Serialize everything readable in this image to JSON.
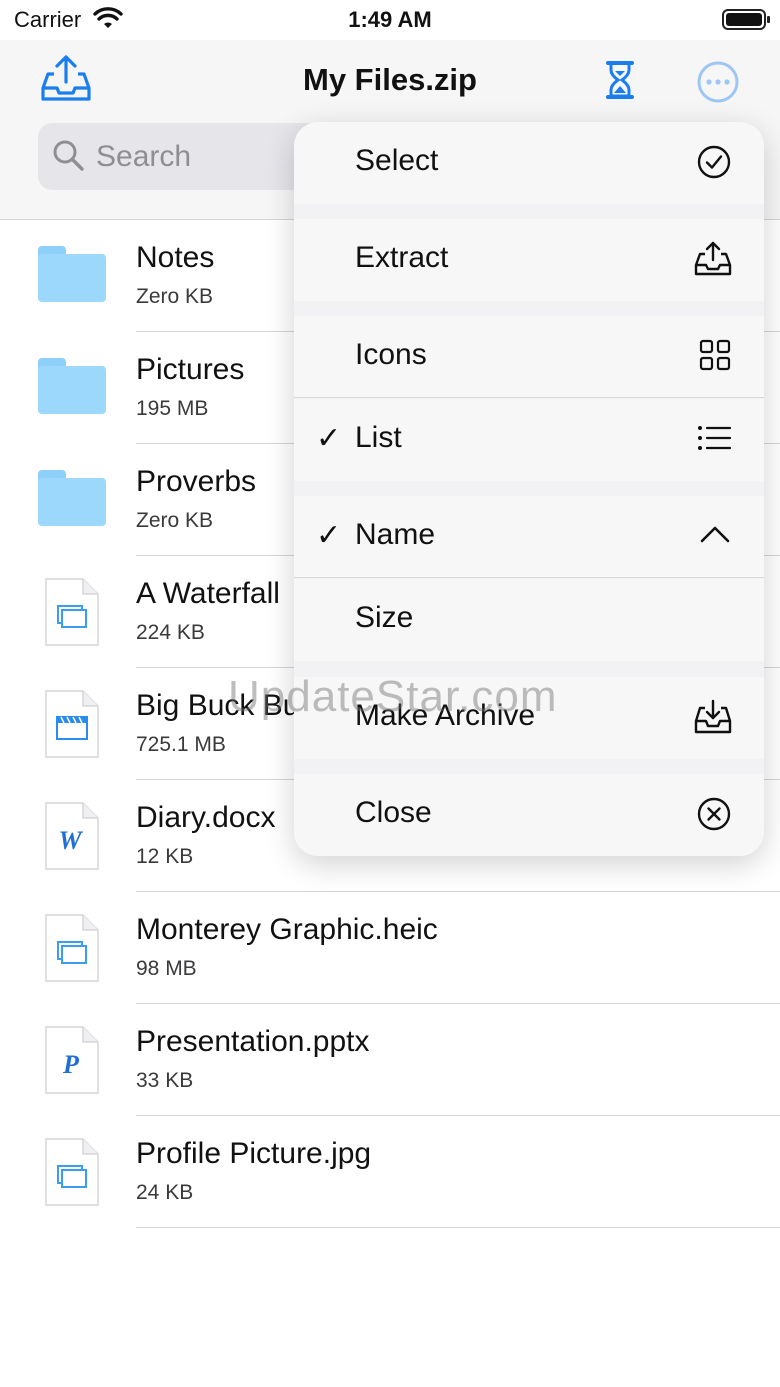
{
  "status_bar": {
    "carrier": "Carrier",
    "time": "1:49 AM"
  },
  "nav": {
    "title": "My Files.zip"
  },
  "search": {
    "placeholder": "Search"
  },
  "files": [
    {
      "name": "Notes",
      "size": "Zero KB",
      "icon": "folder-icon"
    },
    {
      "name": "Pictures",
      "size": "195 MB",
      "icon": "folder-icon"
    },
    {
      "name": "Proverbs",
      "size": "Zero KB",
      "icon": "folder-icon"
    },
    {
      "name": "A Waterfall",
      "size": "224 KB",
      "icon": "image-file-icon"
    },
    {
      "name": "Big Buck Bu",
      "size": "725.1 MB",
      "icon": "video-file-icon"
    },
    {
      "name": "Diary.docx",
      "size": "12 KB",
      "icon": "word-file-icon"
    },
    {
      "name": "Monterey Graphic.heic",
      "size": "98 MB",
      "icon": "image-file-icon"
    },
    {
      "name": "Presentation.pptx",
      "size": "33 KB",
      "icon": "powerpoint-file-icon"
    },
    {
      "name": "Profile Picture.jpg",
      "size": "24 KB",
      "icon": "image-file-icon"
    }
  ],
  "menu": {
    "select": "Select",
    "extract": "Extract",
    "icons": "Icons",
    "list": "List",
    "name": "Name",
    "size": "Size",
    "make_archive": "Make Archive",
    "close": "Close",
    "checkmark": "✓",
    "checked_items": [
      "List",
      "Name"
    ]
  },
  "watermark": "UpdateStar.com",
  "colors": {
    "accent": "#1a7ef0",
    "folder": "#9cd7fc"
  }
}
